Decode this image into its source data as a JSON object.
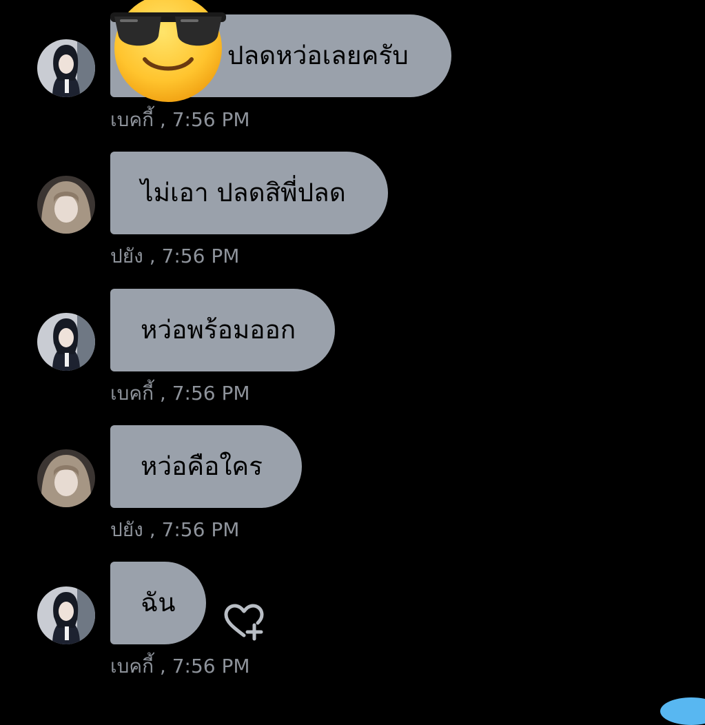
{
  "conversation": {
    "messages": [
      {
        "text": "ปลดหว่อเลยครับ",
        "sender": "เบคกี้",
        "time": "7:56 PM",
        "meta": "เบคกี้ , 7:56 PM",
        "avatar": "avatar-becky"
      },
      {
        "text": "ไม่เอา ปลดสิพี่ปลด",
        "sender": "ปยัง",
        "time": "7:56 PM",
        "meta": "ปยัง , 7:56 PM",
        "avatar": "avatar-pyang"
      },
      {
        "text": "หว่อพร้อมออก",
        "sender": "เบคกี้",
        "time": "7:56 PM",
        "meta": "เบคกี้ , 7:56 PM",
        "avatar": "avatar-becky"
      },
      {
        "text": "หว่อคือใคร",
        "sender": "ปยัง",
        "time": "7:56 PM",
        "meta": "ปยัง , 7:56 PM",
        "avatar": "avatar-pyang"
      },
      {
        "text": "ฉัน",
        "sender": "เบคกี้",
        "time": "7:56 PM",
        "meta": "เบคกี้ , 7:56 PM",
        "avatar": "avatar-becky"
      }
    ]
  },
  "overlay": {
    "sticker_icon": "sunglasses-emoji-icon"
  },
  "actions": {
    "react_icon": "heart-add-icon"
  },
  "colors": {
    "background": "#000000",
    "bubble": "#9aa1ab",
    "bubble_text": "#000000",
    "meta_text": "#8e939b",
    "accent_blue": "#58b7f1"
  }
}
